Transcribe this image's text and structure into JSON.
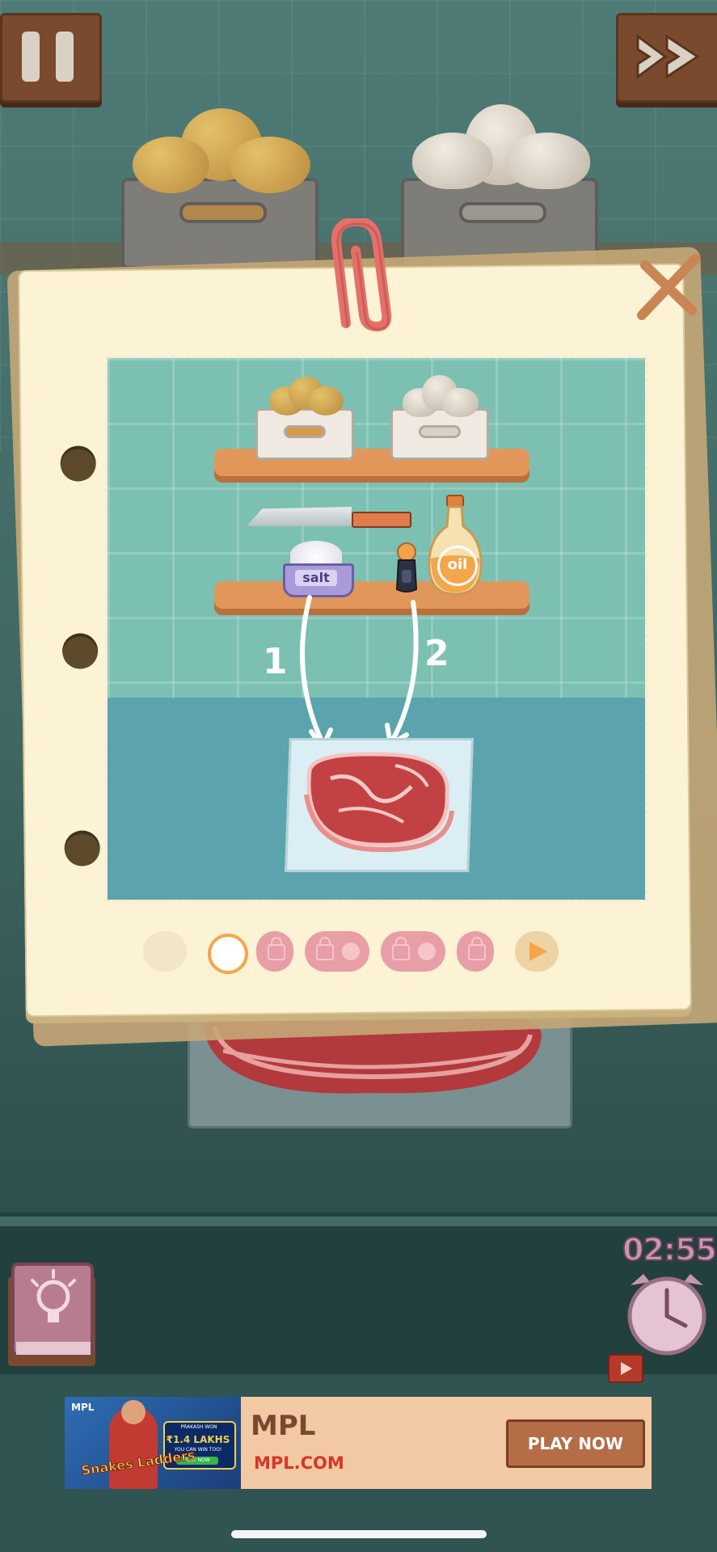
{
  "hud": {
    "timer": "02:55"
  },
  "recipe_card": {
    "salt_label": "salt",
    "oil_label": "oil",
    "step_one": "1",
    "step_two": "2",
    "progress": {
      "current_index": 1,
      "total_steps": 7
    }
  },
  "ad": {
    "title": "MPL",
    "url": "MPL.COM",
    "cta": "PLAY NOW",
    "image": {
      "brand": "MPL",
      "winner_text": "PRAKASH WON",
      "amount": "₹1.4 LAKHS",
      "sub_text": "YOU CAN WIN TOO!",
      "play_text": "PLAY NOW",
      "game_title": "Snakes Ladders"
    }
  },
  "colors": {
    "accent_orange": "#f4a64a",
    "locked_pink": "#e89ea6"
  }
}
